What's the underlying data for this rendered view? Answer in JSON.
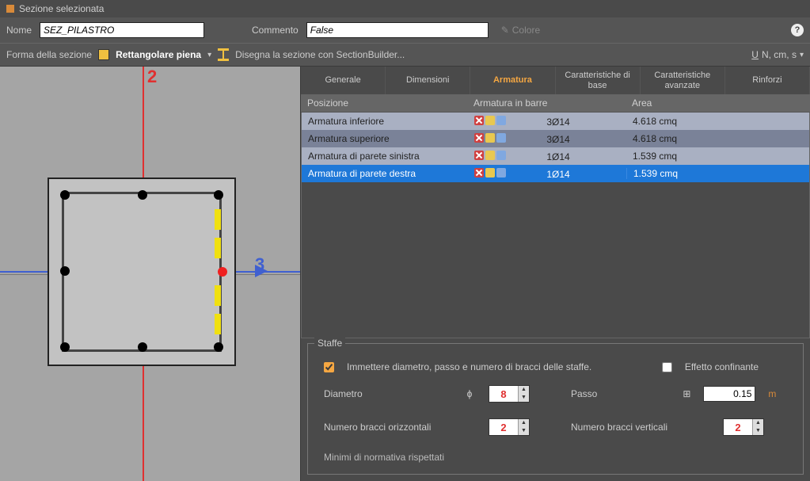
{
  "window": {
    "title": "Sezione selezionata"
  },
  "form": {
    "name_label": "Nome",
    "name_value": "SEZ_PILASTRO",
    "comment_label": "Commento",
    "comment_value": "False",
    "color_label": "Colore"
  },
  "toolbar": {
    "shape_label": "Forma della sezione",
    "shape_value": "Rettangolare piena",
    "builder_label": "Disegna la sezione con SectionBuilder...",
    "units": "N, cm, s",
    "units_prefix": "U"
  },
  "axes": {
    "axis2": "2",
    "axis3": "3"
  },
  "tabs": [
    {
      "label": "Generale"
    },
    {
      "label": "Dimensioni"
    },
    {
      "label": "Armatura",
      "active": true
    },
    {
      "label": "Caratteristiche di base"
    },
    {
      "label": "Caratteristiche avanzate"
    },
    {
      "label": "Rinforzi"
    }
  ],
  "grid": {
    "headers": {
      "pos": "Posizione",
      "arm": "Armatura in barre",
      "area": "Area"
    },
    "rows": [
      {
        "pos": "Armatura inferiore",
        "arm": "3Ø14",
        "area": "4.618 cmq",
        "style": "light"
      },
      {
        "pos": "Armatura superiore",
        "arm": "3Ø14",
        "area": "4.618 cmq",
        "style": "dark"
      },
      {
        "pos": "Armatura di parete sinistra",
        "arm": "1Ø14",
        "area": "1.539 cmq",
        "style": "light"
      },
      {
        "pos": "Armatura di parete destra",
        "arm": "1Ø14",
        "area": "1.539 cmq",
        "style": "selected"
      }
    ]
  },
  "staffe": {
    "legend": "Staffe",
    "immettere_label": "Immettere diametro, passo e numero di bracci delle staffe.",
    "immettere_checked": true,
    "effetto_label": "Effetto confinante",
    "effetto_checked": false,
    "diametro_label": "Diametro",
    "diametro_value": "8",
    "phi": "ϕ",
    "passo_label": "Passo",
    "passo_value": "0.15",
    "passo_unit": "m",
    "bracci_h_label": "Numero bracci orizzontali",
    "bracci_h_value": "2",
    "bracci_v_label": "Numero bracci verticali",
    "bracci_v_value": "2",
    "minimi": "Minimi di normativa rispettati"
  }
}
